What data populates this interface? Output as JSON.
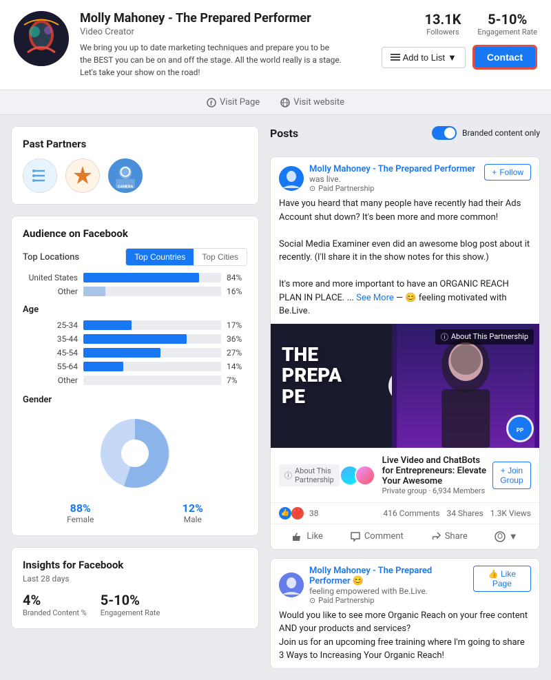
{
  "profile": {
    "name": "Molly Mahoney - The Prepared Performer",
    "type": "Video Creator",
    "bio": "We bring you up to date marketing techniques and prepare you to be the BEST you can be on and off the stage. All the world really is a stage. Let's take your show on the road!",
    "followers": "13.1K",
    "followers_label": "Followers",
    "engagement": "5-10%",
    "engagement_label": "Engagement Rate",
    "add_to_list": "Add to List",
    "contact": "Contact"
  },
  "nav": {
    "visit_page": "Visit Page",
    "visit_website": "Visit website"
  },
  "past_partners": {
    "title": "Past Partners"
  },
  "audience": {
    "title": "Audience on Facebook",
    "top_locations_label": "Top Locations",
    "tab_countries": "Top Countries",
    "tab_cities": "Top Cities",
    "countries": [
      {
        "name": "United States",
        "pct": 84,
        "label": "84%"
      },
      {
        "name": "Other",
        "pct": 16,
        "label": "16%"
      }
    ],
    "age_label": "Age",
    "age_bars": [
      {
        "range": "25-34",
        "pct": 17,
        "label": "17%"
      },
      {
        "range": "35-44",
        "pct": 36,
        "label": "36%"
      },
      {
        "range": "45-54",
        "pct": 27,
        "label": "27%"
      },
      {
        "range": "55-64",
        "pct": 14,
        "label": "14%"
      },
      {
        "range": "Other",
        "pct": 7,
        "label": "7%"
      }
    ],
    "gender_label": "Gender",
    "female_pct": "88%",
    "female_label": "Female",
    "male_pct": "12%",
    "male_label": "Male"
  },
  "insights": {
    "title": "Insights for Facebook",
    "subtitle": "Last 28 days",
    "branded_pct": "4%",
    "branded_label": "Branded Content %",
    "engagement": "5-10%",
    "engagement_label": "Engagement Rate"
  },
  "posts": {
    "title": "Posts",
    "branded_toggle_label": "Branded content only",
    "post1": {
      "author": "Molly Mahoney - The Prepared Performer",
      "status": "was live.",
      "paid": "Paid Partnership",
      "follow_btn": "Follow",
      "text1": "Have you heard that many people have recently had their Ads Account shut down? It's been more and more common!",
      "text2": "Social Media Examiner even did an awesome blog post about it recently. (I'll share it in the show notes for this show.)",
      "text3": "It's more and more important to have an ORGANIC REACH PLAN IN PLACE. ...",
      "see_more": "See More",
      "feeling": "— 😊 feeling motivated with Be.Live.",
      "about_badge": "About This Partnership",
      "reactions": "38",
      "comments": "416 Comments",
      "shares": "34 Shares",
      "views": "1.3K Views",
      "like_label": "Like",
      "comment_label": "Comment",
      "share_label": "Share"
    },
    "group": {
      "name": "Live Video and ChatBots for Entrepreneurs: Elevate Your Awesome",
      "meta": "Private group · 6,934 Members",
      "join_btn": "+ Join Group",
      "about_badge": "About This Partnership"
    },
    "post2": {
      "author": "Molly Mahoney - The Prepared Performer 😊",
      "status": "feeling empowered with Be.Live.",
      "paid": "Paid Partnership",
      "like_page_btn": "👍 Like Page",
      "text": "Would you like to see more Organic Reach on your free content AND your products and services?\nJoin us for an upcoming free training where I'm going to share 3 Ways to Increasing Your Organic Reach!"
    }
  }
}
